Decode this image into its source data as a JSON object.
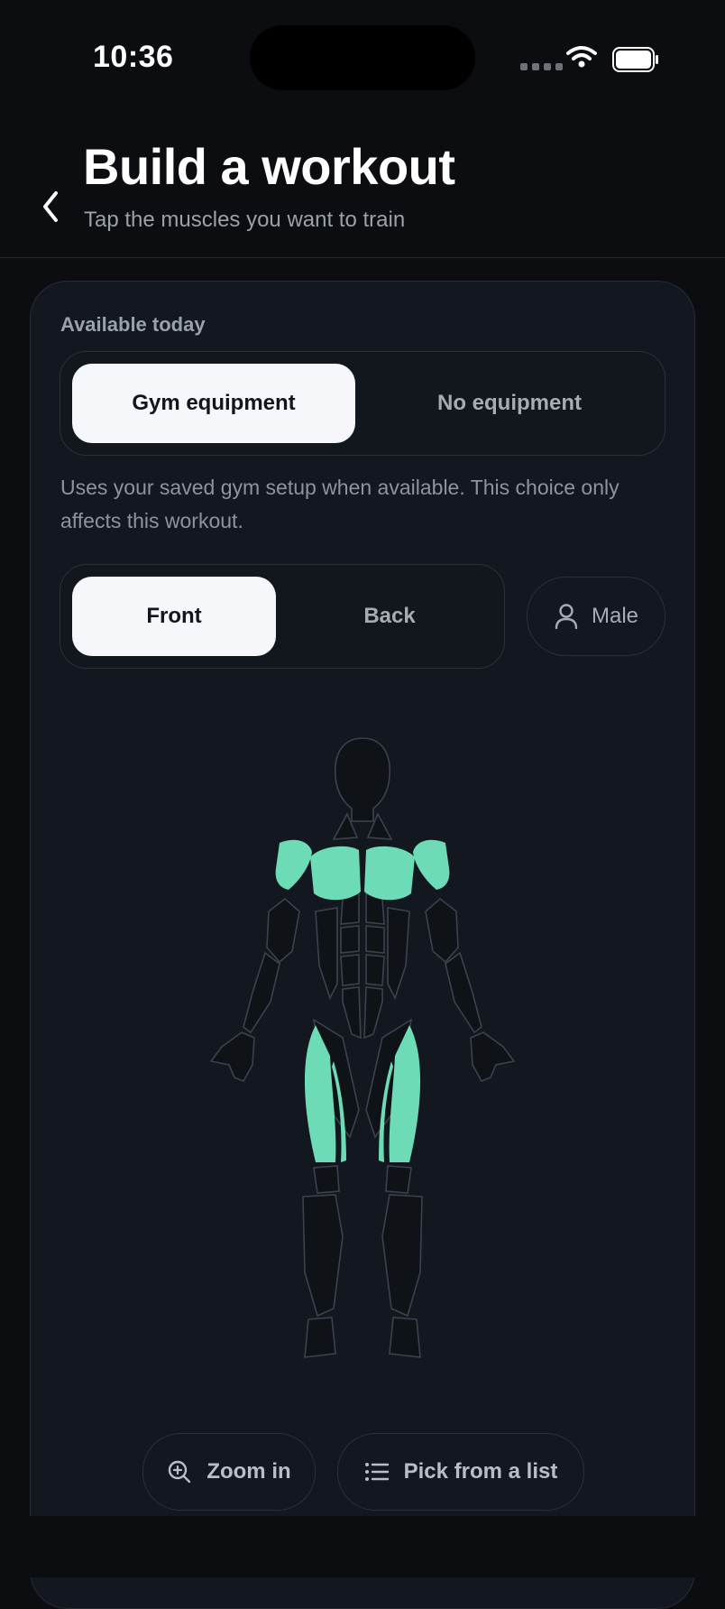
{
  "status_bar": {
    "time": "10:36"
  },
  "header": {
    "title": "Build a workout",
    "subtitle": "Tap the muscles you want to train"
  },
  "equipment": {
    "label": "Available today",
    "options": [
      "Gym equipment",
      "No equipment"
    ],
    "selected": "Gym equipment",
    "description": "Uses your saved gym setup when available. This choice only affects this workout."
  },
  "view": {
    "options": [
      "Front",
      "Back"
    ],
    "selected": "Front"
  },
  "gender": {
    "label": "Male",
    "icon": "person-icon"
  },
  "body_map": {
    "selected_muscles": [
      "shoulders",
      "chest",
      "quadriceps"
    ],
    "highlight_color": "#6ddbb5",
    "outline_color": "#3c424c"
  },
  "actions": {
    "zoom_label": "Zoom in",
    "list_label": "Pick from a list"
  }
}
